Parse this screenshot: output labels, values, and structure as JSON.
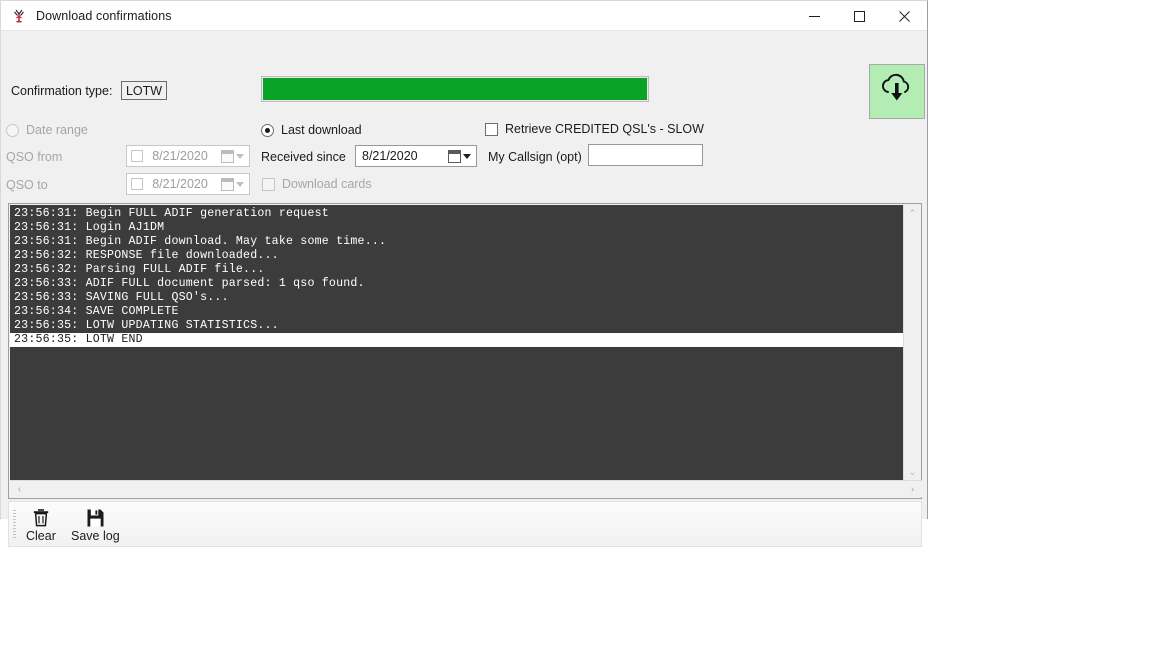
{
  "window": {
    "title": "Download confirmations",
    "icon": "antenna-icon",
    "minimize_label": "—",
    "maximize_label": "☐",
    "close_label": "✕"
  },
  "form": {
    "confirmation_type_label": "Confirmation type:",
    "confirmation_type_value": "LOTW",
    "date_range_label": "Date range",
    "qso_from_label": "QSO from",
    "qso_from_value": "8/21/2020",
    "qso_to_label": "QSO to",
    "qso_to_value": "8/21/2020",
    "last_download_label": "Last download",
    "received_since_label": "Received since",
    "received_since_value": "8/21/2020",
    "download_cards_label": "Download cards",
    "retrieve_credited_label": "Retrieve CREDITED QSL's - SLOW",
    "my_callsign_label": "My Callsign (opt)",
    "my_callsign_value": "",
    "my_callsign_placeholder": ""
  },
  "progress": {
    "percent": 100,
    "fill_color": "#0aa226"
  },
  "download_button": {
    "icon": "cloud-download-icon",
    "background_color": "#b4edb4"
  },
  "log": {
    "background_color": "#3c3c3c",
    "text_color": "#ffffff",
    "lines": [
      {
        "text": "23:56:31: Begin FULL ADIF generation request",
        "selected": false
      },
      {
        "text": "23:56:31: Login AJ1DM",
        "selected": false
      },
      {
        "text": "23:56:31: Begin ADIF download. May take some time...",
        "selected": false
      },
      {
        "text": "23:56:32: RESPONSE file downloaded...",
        "selected": false
      },
      {
        "text": "23:56:32: Parsing FULL ADIF file...",
        "selected": false
      },
      {
        "text": "23:56:33: ADIF FULL document parsed: 1 qso found.",
        "selected": false
      },
      {
        "text": "23:56:33: SAVING FULL QSO's...",
        "selected": false
      },
      {
        "text": "23:56:34: SAVE COMPLETE",
        "selected": false
      },
      {
        "text": "23:56:35: LOTW UPDATING STATISTICS...",
        "selected": false
      },
      {
        "text": "23:56:35: LOTW END",
        "selected": true
      }
    ],
    "scroll_up_glyph": "⌃",
    "scroll_down_glyph": "⌄",
    "scroll_left_glyph": "‹",
    "scroll_right_glyph": "›"
  },
  "toolbar": {
    "clear_label": "Clear",
    "clear_icon": "trash-icon",
    "save_log_label": "Save log",
    "save_log_icon": "floppy-disk-icon"
  }
}
